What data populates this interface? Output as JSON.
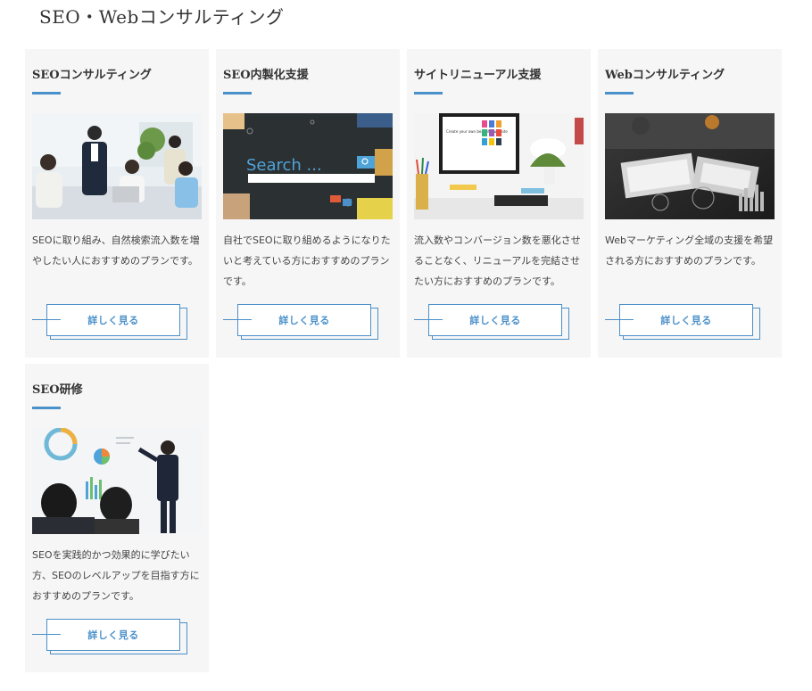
{
  "section": {
    "title": "SEO・Webコンサルティング"
  },
  "cards": [
    {
      "title": "SEOコンサルティング",
      "description": "SEOに取り組み、自然検索流入数を増やしたい人におすすめのプランです。",
      "button_label": "詳しく見る"
    },
    {
      "title": "SEO内製化支援",
      "description": "自社でSEOに取り組めるようになりたいと考えている方におすすめのプランです。",
      "button_label": "詳しく見る",
      "image_text": "Search ..."
    },
    {
      "title": "サイトリニューアル支援",
      "description": "流入数やコンバージョン数を悪化させることなく、リニューアルを完結させたい方におすすめのプランです。",
      "button_label": "詳しく見る",
      "image_text": "Create your own beautiful website"
    },
    {
      "title": "Webコンサルティング",
      "description": "Webマーケティング全域の支援を希望される方におすすめのプランです。",
      "button_label": "詳しく見る"
    },
    {
      "title": "SEO研修",
      "description": "SEOを実践的かつ効果的に学びたい方、SEOのレベルアップを目指す方におすすめのプランです。",
      "button_label": "詳しく見る"
    }
  ],
  "colors": {
    "accent": "#4a90c9",
    "card_bg": "#f6f6f6",
    "text": "#333333"
  }
}
